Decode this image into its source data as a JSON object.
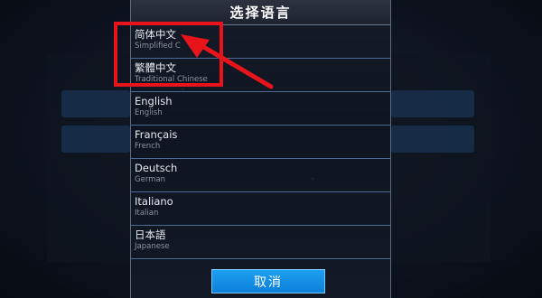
{
  "dialog": {
    "title": "选择语言",
    "cancel_label": "取消"
  },
  "languages": [
    {
      "native": "简体中文",
      "english": "Simplified C"
    },
    {
      "native": "繁體中文",
      "english": "Traditional Chinese"
    },
    {
      "native": "English",
      "english": "English"
    },
    {
      "native": "Français",
      "english": "French"
    },
    {
      "native": "Deutsch",
      "english": "German"
    },
    {
      "native": "Italiano",
      "english": "Italian"
    },
    {
      "native": "日本語",
      "english": "Japanese"
    }
  ],
  "colors": {
    "highlight": "#e8141b",
    "button": "#0c7fd8",
    "divider": "#4c6a93"
  }
}
